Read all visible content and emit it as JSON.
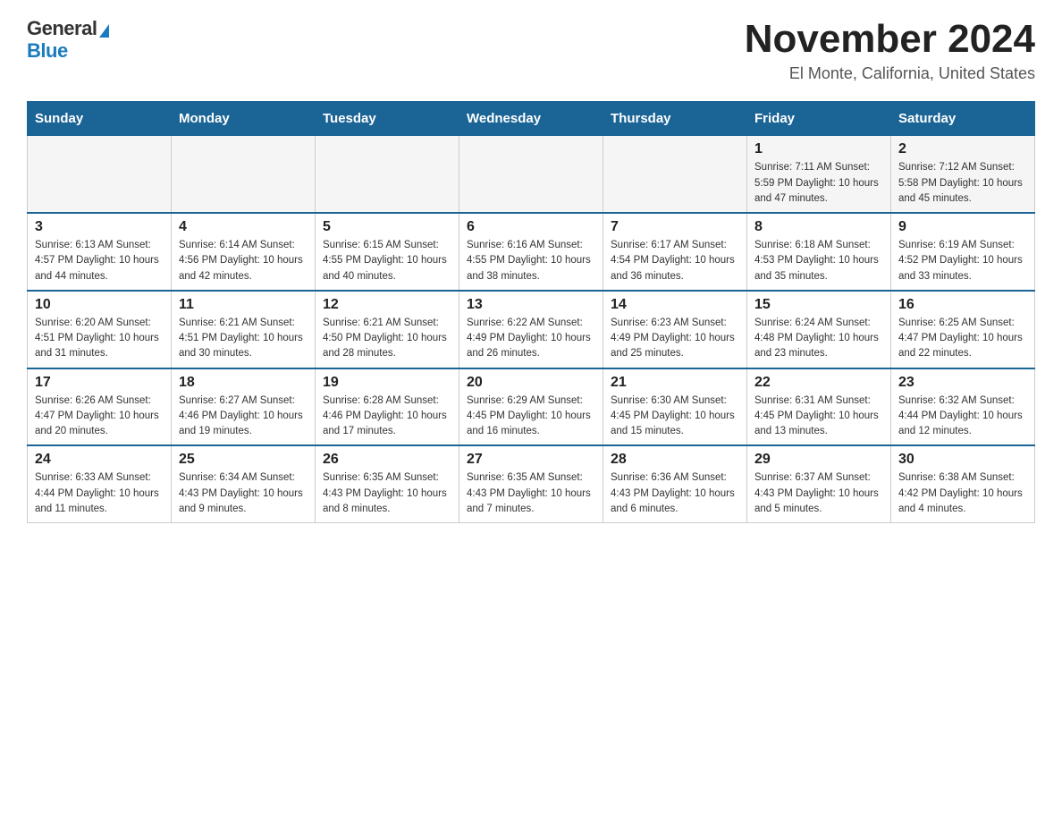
{
  "logo": {
    "general": "General",
    "blue": "Blue"
  },
  "title": "November 2024",
  "subtitle": "El Monte, California, United States",
  "days_of_week": [
    "Sunday",
    "Monday",
    "Tuesday",
    "Wednesday",
    "Thursday",
    "Friday",
    "Saturday"
  ],
  "weeks": [
    [
      {
        "day": "",
        "info": ""
      },
      {
        "day": "",
        "info": ""
      },
      {
        "day": "",
        "info": ""
      },
      {
        "day": "",
        "info": ""
      },
      {
        "day": "",
        "info": ""
      },
      {
        "day": "1",
        "info": "Sunrise: 7:11 AM\nSunset: 5:59 PM\nDaylight: 10 hours and 47 minutes."
      },
      {
        "day": "2",
        "info": "Sunrise: 7:12 AM\nSunset: 5:58 PM\nDaylight: 10 hours and 45 minutes."
      }
    ],
    [
      {
        "day": "3",
        "info": "Sunrise: 6:13 AM\nSunset: 4:57 PM\nDaylight: 10 hours and 44 minutes."
      },
      {
        "day": "4",
        "info": "Sunrise: 6:14 AM\nSunset: 4:56 PM\nDaylight: 10 hours and 42 minutes."
      },
      {
        "day": "5",
        "info": "Sunrise: 6:15 AM\nSunset: 4:55 PM\nDaylight: 10 hours and 40 minutes."
      },
      {
        "day": "6",
        "info": "Sunrise: 6:16 AM\nSunset: 4:55 PM\nDaylight: 10 hours and 38 minutes."
      },
      {
        "day": "7",
        "info": "Sunrise: 6:17 AM\nSunset: 4:54 PM\nDaylight: 10 hours and 36 minutes."
      },
      {
        "day": "8",
        "info": "Sunrise: 6:18 AM\nSunset: 4:53 PM\nDaylight: 10 hours and 35 minutes."
      },
      {
        "day": "9",
        "info": "Sunrise: 6:19 AM\nSunset: 4:52 PM\nDaylight: 10 hours and 33 minutes."
      }
    ],
    [
      {
        "day": "10",
        "info": "Sunrise: 6:20 AM\nSunset: 4:51 PM\nDaylight: 10 hours and 31 minutes."
      },
      {
        "day": "11",
        "info": "Sunrise: 6:21 AM\nSunset: 4:51 PM\nDaylight: 10 hours and 30 minutes."
      },
      {
        "day": "12",
        "info": "Sunrise: 6:21 AM\nSunset: 4:50 PM\nDaylight: 10 hours and 28 minutes."
      },
      {
        "day": "13",
        "info": "Sunrise: 6:22 AM\nSunset: 4:49 PM\nDaylight: 10 hours and 26 minutes."
      },
      {
        "day": "14",
        "info": "Sunrise: 6:23 AM\nSunset: 4:49 PM\nDaylight: 10 hours and 25 minutes."
      },
      {
        "day": "15",
        "info": "Sunrise: 6:24 AM\nSunset: 4:48 PM\nDaylight: 10 hours and 23 minutes."
      },
      {
        "day": "16",
        "info": "Sunrise: 6:25 AM\nSunset: 4:47 PM\nDaylight: 10 hours and 22 minutes."
      }
    ],
    [
      {
        "day": "17",
        "info": "Sunrise: 6:26 AM\nSunset: 4:47 PM\nDaylight: 10 hours and 20 minutes."
      },
      {
        "day": "18",
        "info": "Sunrise: 6:27 AM\nSunset: 4:46 PM\nDaylight: 10 hours and 19 minutes."
      },
      {
        "day": "19",
        "info": "Sunrise: 6:28 AM\nSunset: 4:46 PM\nDaylight: 10 hours and 17 minutes."
      },
      {
        "day": "20",
        "info": "Sunrise: 6:29 AM\nSunset: 4:45 PM\nDaylight: 10 hours and 16 minutes."
      },
      {
        "day": "21",
        "info": "Sunrise: 6:30 AM\nSunset: 4:45 PM\nDaylight: 10 hours and 15 minutes."
      },
      {
        "day": "22",
        "info": "Sunrise: 6:31 AM\nSunset: 4:45 PM\nDaylight: 10 hours and 13 minutes."
      },
      {
        "day": "23",
        "info": "Sunrise: 6:32 AM\nSunset: 4:44 PM\nDaylight: 10 hours and 12 minutes."
      }
    ],
    [
      {
        "day": "24",
        "info": "Sunrise: 6:33 AM\nSunset: 4:44 PM\nDaylight: 10 hours and 11 minutes."
      },
      {
        "day": "25",
        "info": "Sunrise: 6:34 AM\nSunset: 4:43 PM\nDaylight: 10 hours and 9 minutes."
      },
      {
        "day": "26",
        "info": "Sunrise: 6:35 AM\nSunset: 4:43 PM\nDaylight: 10 hours and 8 minutes."
      },
      {
        "day": "27",
        "info": "Sunrise: 6:35 AM\nSunset: 4:43 PM\nDaylight: 10 hours and 7 minutes."
      },
      {
        "day": "28",
        "info": "Sunrise: 6:36 AM\nSunset: 4:43 PM\nDaylight: 10 hours and 6 minutes."
      },
      {
        "day": "29",
        "info": "Sunrise: 6:37 AM\nSunset: 4:43 PM\nDaylight: 10 hours and 5 minutes."
      },
      {
        "day": "30",
        "info": "Sunrise: 6:38 AM\nSunset: 4:42 PM\nDaylight: 10 hours and 4 minutes."
      }
    ]
  ]
}
